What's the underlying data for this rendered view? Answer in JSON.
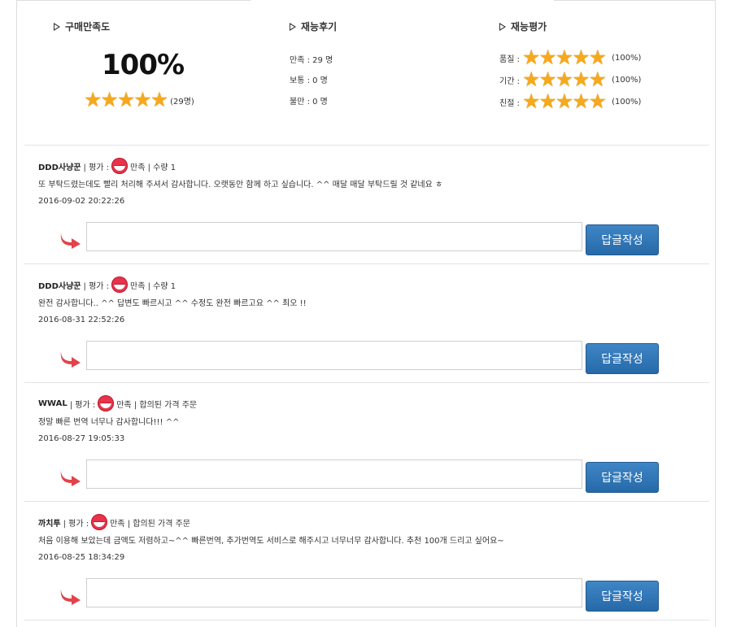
{
  "summary": {
    "satisfaction": {
      "title": "구매만족도",
      "percent": "100%",
      "stars": 5,
      "count": "(29명)"
    },
    "reviews": {
      "title": "재능후기",
      "lines": [
        "만족 : 29 명",
        "보통 : 0 명",
        "불만 : 0 명"
      ]
    },
    "evaluation": {
      "title": "재능평가",
      "rows": [
        {
          "label": "품질 :",
          "stars": 5,
          "pct": "(100%)"
        },
        {
          "label": "기간 :",
          "stars": 5,
          "pct": "(100%)"
        },
        {
          "label": "친절 :",
          "stars": 5,
          "pct": "(100%)"
        }
      ]
    }
  },
  "rating_label": "| 평가 :",
  "reply_button_label": "답글작성",
  "reviews": [
    {
      "author": "DDD사냥꾼",
      "rating": "만족",
      "detail": "| 수량 1",
      "content": "또 부탁드렸는데도 빨리 처리해 주셔서 감사합니다. 오랫동안 함께 하고 싶습니다. ^^ 매달 매달 부탁드릴 것 같네요 ㅎ",
      "date": "2016-09-02 20:22:26"
    },
    {
      "author": "DDD사냥꾼",
      "rating": "만족",
      "detail": "| 수량 1",
      "content": "완전 감사합니다.. ^^ 답변도 빠르시고 ^^ 수정도 완전 빠르고요 ^^ 최오 !!",
      "date": "2016-08-31 22:52:26"
    },
    {
      "author": "WWAL",
      "rating": "만족",
      "detail": "| 합의된 가격 주문",
      "content": "정말 빠른 번역 너무나 감사합니다!!! ^^",
      "date": "2016-08-27 19:05:33"
    },
    {
      "author": "까치투",
      "rating": "만족",
      "detail": "| 합의된 가격 주문",
      "content": "처음 이용해 보았는데 금액도 저렴하고~^^ 빠른번역, 추가번역도 서비스로 해주시고 너무너무 감사합니다. 추천 100개 드리고 싶어요~",
      "date": "2016-08-25 18:34:29"
    }
  ],
  "colors": {
    "star": "#f5a91d",
    "button": "#2f74b5",
    "smile": "#e8334a",
    "arrow": "#e2434b"
  }
}
